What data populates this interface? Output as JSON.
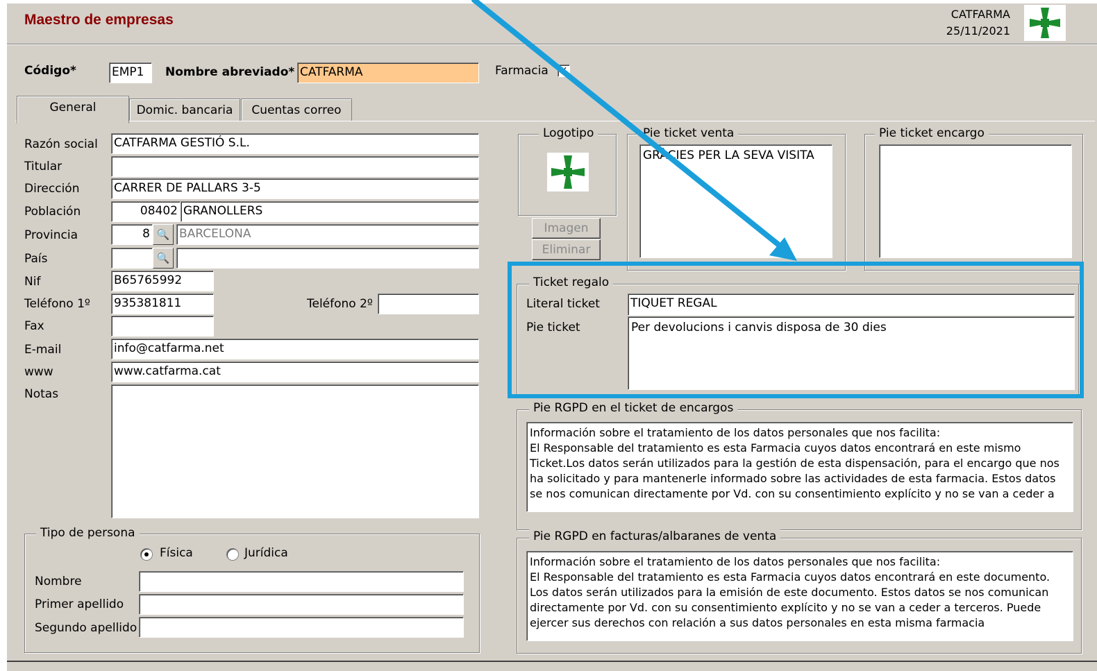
{
  "window": {
    "title": "Maestro de empresas",
    "company": "CATFARMA",
    "date": "25/11/2021",
    "logo_icon": "green-cross-icon"
  },
  "header": {
    "codigo_label": "Código*",
    "codigo_value": "EMP1",
    "nombre_label": "Nombre abreviado*",
    "nombre_value": "CATFARMA",
    "farmacia_label": "Farmacia",
    "farmacia_checked": true
  },
  "tabs": [
    {
      "label": "General",
      "active": true
    },
    {
      "label": "Domic. bancaria",
      "active": false
    },
    {
      "label": "Cuentas correo",
      "active": false
    }
  ],
  "general": {
    "razon_social": {
      "label": "Razón social",
      "value": "CATFARMA GESTIÓ S.L."
    },
    "titular": {
      "label": "Titular",
      "value": ""
    },
    "direccion": {
      "label": "Dirección",
      "value": "CARRER DE PALLARS 3-5"
    },
    "poblacion": {
      "label": "Población",
      "cp": "08402",
      "value": "GRANOLLERS"
    },
    "provincia": {
      "label": "Provincia",
      "code": "8",
      "value": "BARCELONA"
    },
    "pais": {
      "label": "País",
      "code": "",
      "value": ""
    },
    "nif": {
      "label": "Nif",
      "value": "B65765992"
    },
    "telefono1": {
      "label": "Teléfono 1º",
      "value": "935381811"
    },
    "telefono2": {
      "label": "Teléfono 2º",
      "value": ""
    },
    "fax": {
      "label": "Fax",
      "value": ""
    },
    "email": {
      "label": "E-mail",
      "value": "info@catfarma.net"
    },
    "www": {
      "label": "www",
      "value": "www.catfarma.cat"
    },
    "notas": {
      "label": "Notas",
      "value": ""
    }
  },
  "tipo_persona": {
    "legend": "Tipo de persona",
    "fisica": "Física",
    "juridica": "Jurídica",
    "selected": "fisica",
    "nombre_label": "Nombre",
    "nombre_value": "",
    "primer_apellido_label": "Primer apellido",
    "primer_apellido_value": "",
    "segundo_apellido_label": "Segundo apellido",
    "segundo_apellido_value": ""
  },
  "logotipo": {
    "legend": "Logotipo",
    "imagen_button": "Imagen",
    "eliminar_button": "Eliminar"
  },
  "pie_ticket_venta": {
    "legend": "Pie ticket venta",
    "value": "GRÀCIES PER LA SEVA VISITA"
  },
  "pie_ticket_encargo": {
    "legend": "Pie ticket encargo",
    "value": ""
  },
  "ticket_regalo": {
    "legend": "Ticket regalo",
    "literal_label": "Literal ticket",
    "literal_value": "TIQUET REGAL",
    "pie_label": "Pie ticket",
    "pie_value": "Per devolucions i canvis disposa de 30 dies"
  },
  "rgpd_encargos": {
    "legend": "Pie RGPD en el ticket de encargos",
    "text": "Información sobre el tratamiento de los datos personales que nos facilita:\nEl Responsable del tratamiento es esta Farmacia cuyos datos encontrará en este mismo Ticket.Los datos serán utilizados para la gestión de esta dispensación, para el encargo que nos ha solicitado y para mantenerle informado sobre las actividades de esta farmacia. Estos datos se nos comunican directamente por Vd. con su consentimiento explícito y no se van a ceder a"
  },
  "rgpd_facturas": {
    "legend": "Pie RGPD en facturas/albaranes de venta",
    "text": "Información sobre el tratamiento de los datos personales que nos facilita:\nEl Responsable del tratamiento es esta Farmacia cuyos datos encontrará en este documento.\nLos datos serán utilizados para la emisión de este documento. Estos datos se nos comunican directamente por Vd. con su consentimiento explícito y no se van a ceder a terceros. Puede ejercer sus derechos con relación a sus datos personales en esta misma farmacia"
  },
  "annotation": {
    "highlight_color": "#1a9fdb",
    "target": "ticket_regalo"
  }
}
